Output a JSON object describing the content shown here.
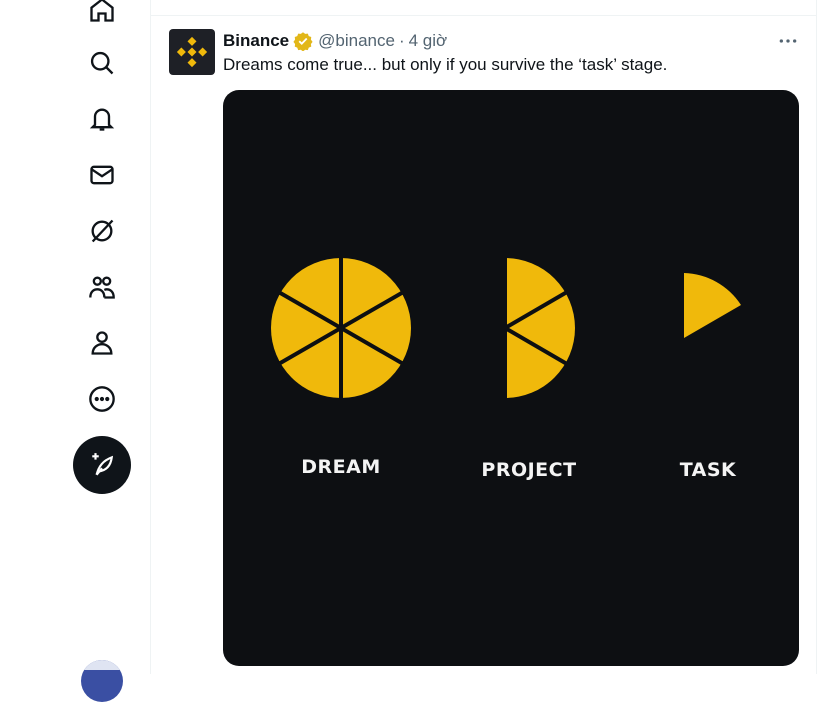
{
  "sidebar": {
    "icons": [
      "home-icon",
      "search-icon",
      "notifications-icon",
      "messages-icon",
      "grok-icon",
      "communities-icon",
      "profile-icon",
      "more-icon"
    ],
    "compose_icon": "compose-feather-icon"
  },
  "tweet": {
    "author_name": "Binance",
    "handle": "@binance",
    "separator": "·",
    "time": "4 giờ",
    "text": "Dreams come true... but only if you survive the ‘task’ stage.",
    "media": {
      "labels": [
        "DREAM",
        "PROJECT",
        "TASK"
      ],
      "slice_color": "#f0b90b",
      "background": "#0d0f12"
    }
  },
  "colors": {
    "brand_gold": "#f0b90b",
    "verified_gold": "#e2b719",
    "muted_text": "#536471"
  }
}
